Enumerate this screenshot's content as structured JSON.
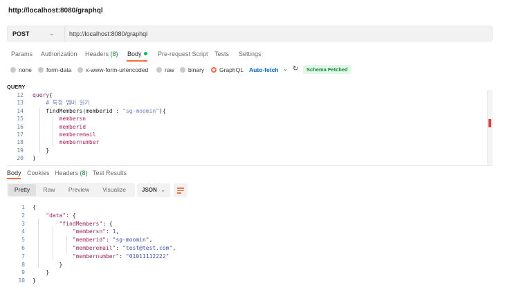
{
  "request_title": "http://localhost:8080/graphql",
  "url_bar": {
    "method": "POST",
    "url": "http://localhost:8080/graphql"
  },
  "request_tabs": [
    {
      "label": "Params"
    },
    {
      "label": "Authorization"
    },
    {
      "label": "Headers",
      "count": "(8)"
    },
    {
      "label": "Body"
    },
    {
      "label": "Pre-request Script"
    },
    {
      "label": "Tests"
    },
    {
      "label": "Settings"
    }
  ],
  "body_types": [
    {
      "label": "none"
    },
    {
      "label": "form-data"
    },
    {
      "label": "x-www-form-urlencoded"
    },
    {
      "label": "raw"
    },
    {
      "label": "binary"
    },
    {
      "label": "GraphQL",
      "selected": true
    }
  ],
  "auto_fetch_label": "Auto-fetch",
  "schema_badge": "Schema Fetched",
  "query_label": "QUERY",
  "query_lines": [
    {
      "num": "12",
      "tokens": [
        {
          "t": "query",
          "c": "kw"
        },
        {
          "t": "{",
          "c": "plain"
        }
      ]
    },
    {
      "num": "13",
      "tokens": [
        {
          "t": "    # 특정 멤버 읽기",
          "c": "cm"
        }
      ]
    },
    {
      "num": "14",
      "tokens": [
        {
          "t": "    findMembers",
          "c": "plain"
        },
        {
          "t": "(",
          "c": "plain"
        },
        {
          "t": "memberid",
          "c": "plain"
        },
        {
          "t": " : ",
          "c": "plain"
        },
        {
          "t": "\"sg-moomin\"",
          "c": "str"
        },
        {
          "t": "){",
          "c": "plain"
        }
      ]
    },
    {
      "num": "15",
      "tokens": [
        {
          "t": "        membersn",
          "c": "fld"
        }
      ]
    },
    {
      "num": "16",
      "tokens": [
        {
          "t": "        memberid",
          "c": "fld"
        }
      ]
    },
    {
      "num": "17",
      "tokens": [
        {
          "t": "        memberemail",
          "c": "fld"
        }
      ]
    },
    {
      "num": "18",
      "tokens": [
        {
          "t": "        membernumber",
          "c": "fld"
        }
      ]
    },
    {
      "num": "19",
      "tokens": [
        {
          "t": "    }",
          "c": "plain"
        }
      ]
    },
    {
      "num": "20",
      "tokens": [
        {
          "t": "}",
          "c": "plain"
        }
      ]
    }
  ],
  "response_tabs": [
    {
      "label": "Body"
    },
    {
      "label": "Cookies"
    },
    {
      "label": "Headers",
      "count": "(8)"
    },
    {
      "label": "Test Results"
    }
  ],
  "view_modes": [
    "Pretty",
    "Raw",
    "Preview",
    "Visualize"
  ],
  "format_select": "JSON",
  "response_lines": [
    {
      "num": "1",
      "tokens": [
        {
          "t": "{",
          "c": "plain"
        }
      ]
    },
    {
      "num": "2",
      "tokens": [
        {
          "t": "    ",
          "c": "plain"
        },
        {
          "t": "\"data\"",
          "c": "key"
        },
        {
          "t": ": {",
          "c": "plain"
        }
      ]
    },
    {
      "num": "3",
      "tokens": [
        {
          "t": "        ",
          "c": "plain"
        },
        {
          "t": "\"findMembers\"",
          "c": "key"
        },
        {
          "t": ": {",
          "c": "plain"
        }
      ]
    },
    {
      "num": "4",
      "tokens": [
        {
          "t": "            ",
          "c": "plain"
        },
        {
          "t": "\"membersn\"",
          "c": "key"
        },
        {
          "t": ": ",
          "c": "plain"
        },
        {
          "t": "1",
          "c": "nval"
        },
        {
          "t": ",",
          "c": "plain"
        }
      ]
    },
    {
      "num": "5",
      "tokens": [
        {
          "t": "            ",
          "c": "plain"
        },
        {
          "t": "\"memberid\"",
          "c": "key"
        },
        {
          "t": ": ",
          "c": "plain"
        },
        {
          "t": "\"sg-moomin\"",
          "c": "sval"
        },
        {
          "t": ",",
          "c": "plain"
        }
      ]
    },
    {
      "num": "6",
      "tokens": [
        {
          "t": "            ",
          "c": "plain"
        },
        {
          "t": "\"memberemail\"",
          "c": "key"
        },
        {
          "t": ": ",
          "c": "plain"
        },
        {
          "t": "\"test@test.com\"",
          "c": "sval"
        },
        {
          "t": ",",
          "c": "plain"
        }
      ]
    },
    {
      "num": "7",
      "tokens": [
        {
          "t": "            ",
          "c": "plain"
        },
        {
          "t": "\"membernumber\"",
          "c": "key"
        },
        {
          "t": ": ",
          "c": "plain"
        },
        {
          "t": "\"01011112222\"",
          "c": "sval"
        }
      ]
    },
    {
      "num": "8",
      "tokens": [
        {
          "t": "        }",
          "c": "plain"
        }
      ]
    },
    {
      "num": "9",
      "tokens": [
        {
          "t": "    }",
          "c": "plain"
        }
      ]
    },
    {
      "num": "10",
      "tokens": [
        {
          "t": "}",
          "c": "plain"
        }
      ]
    }
  ],
  "colors": {
    "accent_orange": "#ff6c37",
    "success_green": "#0cbb52",
    "link_blue": "#0265d2"
  }
}
